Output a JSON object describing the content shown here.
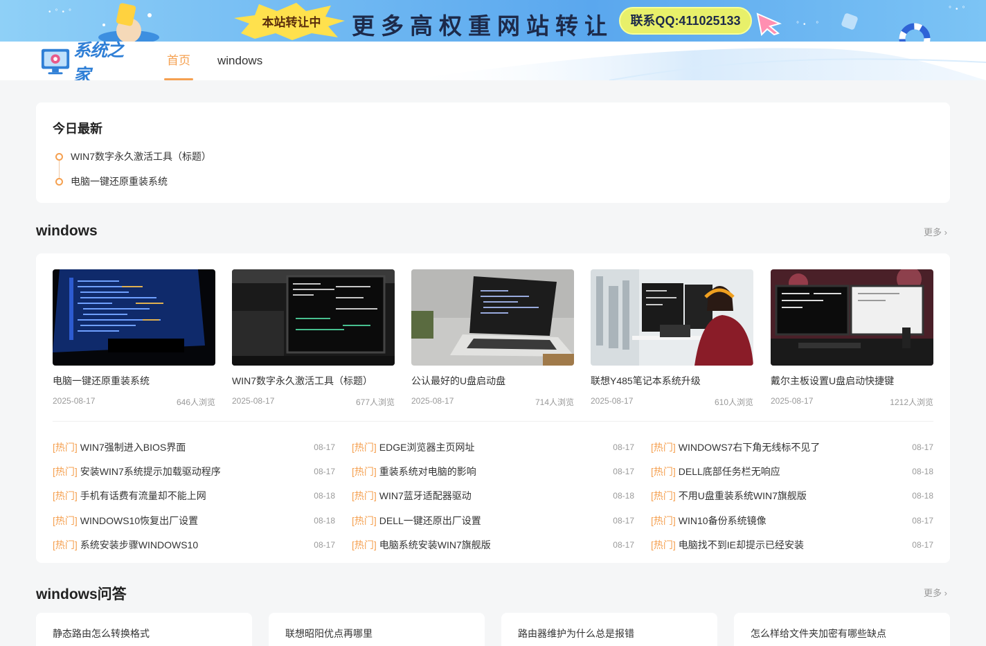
{
  "banner": {
    "badge": "本站转让中",
    "headline": "更多高权重网站转让",
    "contact": "联系QQ:411025133"
  },
  "nav": {
    "logo_text": "系统之家",
    "items": [
      {
        "label": "首页",
        "active": true
      },
      {
        "label": "windows",
        "active": false
      }
    ]
  },
  "today": {
    "title": "今日最新",
    "items": [
      "WIN7数字永久激活工具（标题）",
      "电脑一键还原重装系统"
    ]
  },
  "windows_section": {
    "title": "windows",
    "more": "更多",
    "cards": [
      {
        "title": "电脑一键还原重装系统",
        "date": "2025-08-17",
        "views": "646人浏览"
      },
      {
        "title": "WIN7数字永久激活工具（标题）",
        "date": "2025-08-17",
        "views": "677人浏览"
      },
      {
        "title": "公认最好的U盘启动盘",
        "date": "2025-08-17",
        "views": "714人浏览"
      },
      {
        "title": "联想Y485笔记本系统升级",
        "date": "2025-08-17",
        "views": "610人浏览"
      },
      {
        "title": "戴尔主板设置U盘启动快捷键",
        "date": "2025-08-17",
        "views": "1212人浏览"
      }
    ],
    "hot_tag": "[热门]",
    "hot_columns": [
      [
        {
          "title": "WIN7强制进入BIOS界面",
          "date": "08-17"
        },
        {
          "title": "安装WIN7系统提示加载驱动程序",
          "date": "08-17"
        },
        {
          "title": "手机有话费有流量却不能上网",
          "date": "08-18"
        },
        {
          "title": "WINDOWS10恢复出厂设置",
          "date": "08-18"
        },
        {
          "title": "系统安装步骤WINDOWS10",
          "date": "08-17"
        }
      ],
      [
        {
          "title": "EDGE浏览器主页网址",
          "date": "08-17"
        },
        {
          "title": "重装系统对电脑的影响",
          "date": "08-17"
        },
        {
          "title": "WIN7蓝牙适配器驱动",
          "date": "08-18"
        },
        {
          "title": "DELL一键还原出厂设置",
          "date": "08-17"
        },
        {
          "title": "电脑系统安装WIN7旗舰版",
          "date": "08-17"
        }
      ],
      [
        {
          "title": "WINDOWS7右下角无线标不见了",
          "date": "08-17"
        },
        {
          "title": "DELL底部任务栏无响应",
          "date": "08-18"
        },
        {
          "title": "不用U盘重装系统WIN7旗舰版",
          "date": "08-18"
        },
        {
          "title": "WIN10备份系统镜像",
          "date": "08-17"
        },
        {
          "title": "电脑找不到IE却提示已经安装",
          "date": "08-17"
        }
      ]
    ]
  },
  "qa_section": {
    "title": "windows问答",
    "more": "更多",
    "items": [
      "静态路由怎么转换格式",
      "联想昭阳优点再哪里",
      "路由器维护为什么总是报错",
      "怎么样给文件夹加密有哪些缺点"
    ]
  },
  "colors": {
    "accent": "#f5a050",
    "banner": "#6fb8f2",
    "logo": "#2f7fd6"
  }
}
